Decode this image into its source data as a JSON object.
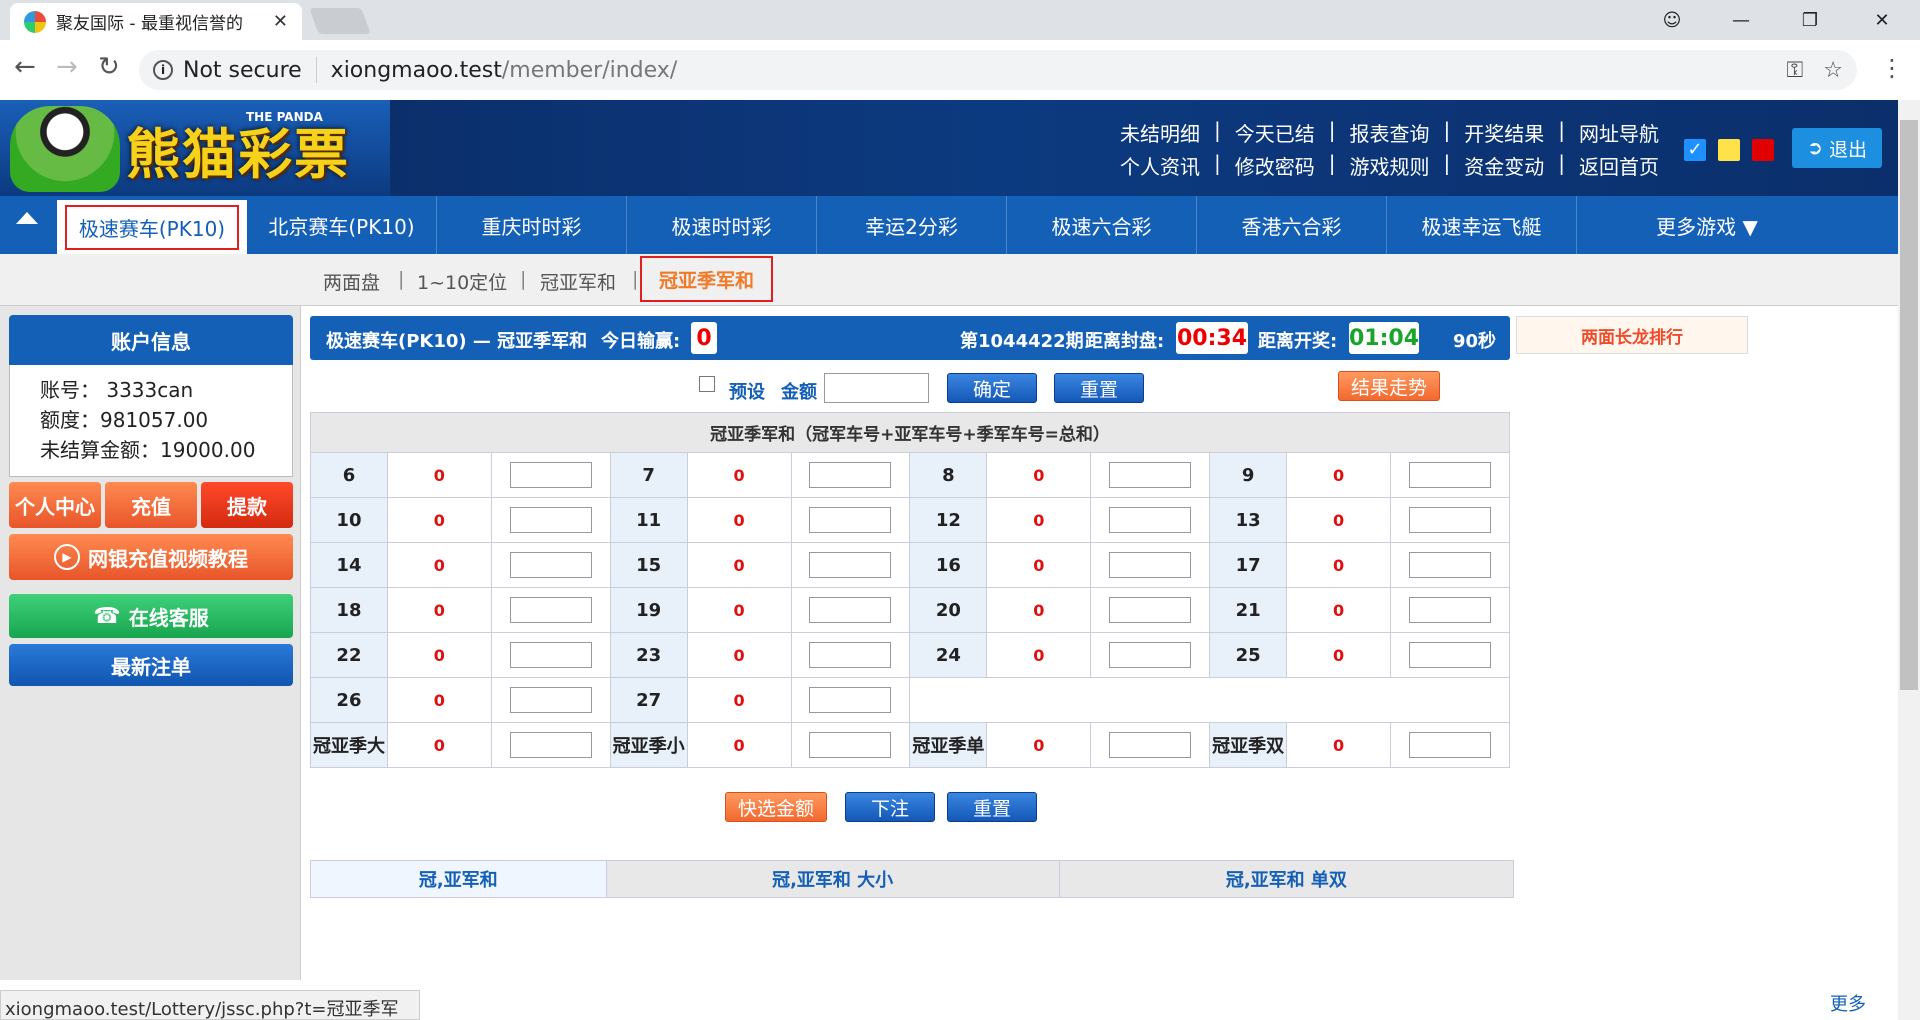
{
  "browser": {
    "tab_title": "聚友国际 - 最重视信誉的",
    "tab_close": "✕",
    "url_security": "Not secure",
    "url_domain": "xiongmaoo.test",
    "url_path": "/member/index/",
    "status_url": "xiongmaoo.test/Lottery/jssc.php?t=冠亚季军和"
  },
  "header": {
    "logo_text": "熊猫彩票",
    "logo_sub": "THE PANDA",
    "links_row1": [
      "未结明细",
      "今天已结",
      "报表查询",
      "开奖结果",
      "网址导航"
    ],
    "links_row2": [
      "个人资讯",
      "修改密码",
      "游戏规则",
      "资金变动",
      "返回首页"
    ],
    "theme_colors": [
      "#1e90ff",
      "#ffe14a",
      "#e00000"
    ],
    "logout_label": "退出"
  },
  "main_nav": {
    "active": "极速赛车(PK10)",
    "items": [
      "北京赛车(PK10)",
      "重庆时时彩",
      "极速时时彩",
      "幸运2分彩",
      "极速六合彩",
      "香港六合彩",
      "极速幸运飞艇"
    ],
    "more": "更多游戏 ▼"
  },
  "sub_nav": {
    "items": [
      "两面盘",
      "1~10定位",
      "冠亚军和"
    ],
    "active": "冠亚季军和"
  },
  "sidebar": {
    "account_title": "账户信息",
    "account_no": "账号： 3333can",
    "credit": "额度：981057.00",
    "unsettled": "未结算金额：19000.00",
    "btn_center": "个人中心",
    "btn_deposit": "充值",
    "btn_withdraw": "提款",
    "btn_video": "网银充值视频教程",
    "btn_service": "在线客服",
    "btn_latest": "最新注单"
  },
  "game_bar": {
    "title": "极速赛车(PK10) — 冠亚季军和",
    "today_label": "今日输赢:",
    "today_value": "0",
    "period": "第1044422期",
    "close_label": "距离封盘:",
    "close_timer": "00:34",
    "open_label": "距离开奖:",
    "open_timer": "01:04",
    "seconds": "90秒",
    "rank_title": "两面长龙排行"
  },
  "controls": {
    "preset_label": "预设",
    "amount_label": "金额",
    "confirm": "确定",
    "reset": "重置",
    "trend": "结果走势"
  },
  "bet_table": {
    "header": "冠亚季军和（冠军车号+亚军车号+季军车号=总和）",
    "rows": [
      [
        {
          "n": "6",
          "o": "0"
        },
        {
          "n": "7",
          "o": "0"
        },
        {
          "n": "8",
          "o": "0"
        },
        {
          "n": "9",
          "o": "0"
        }
      ],
      [
        {
          "n": "10",
          "o": "0"
        },
        {
          "n": "11",
          "o": "0"
        },
        {
          "n": "12",
          "o": "0"
        },
        {
          "n": "13",
          "o": "0"
        }
      ],
      [
        {
          "n": "14",
          "o": "0"
        },
        {
          "n": "15",
          "o": "0"
        },
        {
          "n": "16",
          "o": "0"
        },
        {
          "n": "17",
          "o": "0"
        }
      ],
      [
        {
          "n": "18",
          "o": "0"
        },
        {
          "n": "19",
          "o": "0"
        },
        {
          "n": "20",
          "o": "0"
        },
        {
          "n": "21",
          "o": "0"
        }
      ],
      [
        {
          "n": "22",
          "o": "0"
        },
        {
          "n": "23",
          "o": "0"
        },
        {
          "n": "24",
          "o": "0"
        },
        {
          "n": "25",
          "o": "0"
        }
      ],
      [
        {
          "n": "26",
          "o": "0"
        },
        {
          "n": "27",
          "o": "0"
        }
      ],
      [
        {
          "n": "冠亚季大",
          "o": "0"
        },
        {
          "n": "冠亚季小",
          "o": "0"
        },
        {
          "n": "冠亚季单",
          "o": "0"
        },
        {
          "n": "冠亚季双",
          "o": "0"
        }
      ]
    ]
  },
  "bottom_controls": {
    "quick": "快选金额",
    "submit": "下注",
    "reset": "重置"
  },
  "stats_tabs": [
    "冠,亚军和",
    "冠,亚军和 大小",
    "冠,亚军和 单双"
  ],
  "more_link": "更多"
}
